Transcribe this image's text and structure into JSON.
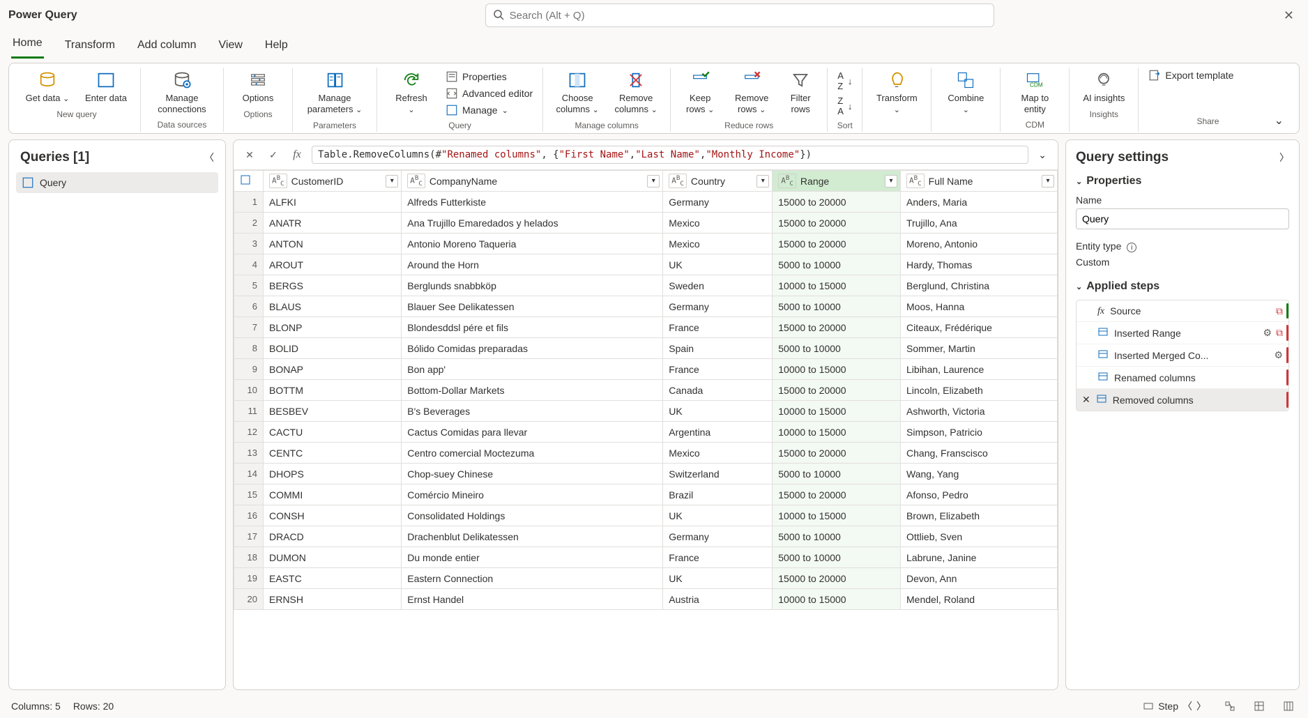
{
  "title": "Power Query",
  "search_placeholder": "Search (Alt + Q)",
  "tabs": [
    "Home",
    "Transform",
    "Add column",
    "View",
    "Help"
  ],
  "active_tab": 0,
  "ribbon": {
    "get_data": "Get data",
    "enter_data": "Enter data",
    "new_query": "New query",
    "manage_connections": "Manage connections",
    "data_sources": "Data sources",
    "options": "Options",
    "options_group": "Options",
    "manage_parameters": "Manage parameters",
    "parameters": "Parameters",
    "refresh": "Refresh",
    "properties": "Properties",
    "advanced_editor": "Advanced editor",
    "manage": "Manage",
    "query_group": "Query",
    "choose_columns": "Choose columns",
    "remove_columns": "Remove columns",
    "manage_columns": "Manage columns",
    "keep_rows": "Keep rows",
    "remove_rows": "Remove rows",
    "filter_rows": "Filter rows",
    "reduce_rows": "Reduce rows",
    "sort": "Sort",
    "transform": "Transform",
    "combine": "Combine",
    "map_to_entity": "Map to entity",
    "cdm": "CDM",
    "ai_insights": "AI insights",
    "insights": "Insights",
    "export_template": "Export template",
    "share": "Share"
  },
  "queries": {
    "title": "Queries [1]",
    "items": [
      "Query"
    ]
  },
  "formula": {
    "prefix": "Table.RemoveColumns(#",
    "arg1": "\"Renamed columns\"",
    "mid": ", {",
    "s1": "\"First Name\"",
    "s2": "\"Last Name\"",
    "s3": "\"Monthly Income\"",
    "suffix": "})"
  },
  "columns": [
    {
      "label": "CustomerID",
      "type": "ABC",
      "selected": false
    },
    {
      "label": "CompanyName",
      "type": "ABC",
      "selected": false
    },
    {
      "label": "Country",
      "type": "ABC",
      "selected": false
    },
    {
      "label": "Range",
      "type": "ABC",
      "selected": true
    },
    {
      "label": "Full Name",
      "type": "ABC",
      "selected": false
    }
  ],
  "rows": [
    [
      "ALFKI",
      "Alfreds Futterkiste",
      "Germany",
      "15000 to 20000",
      "Anders, Maria"
    ],
    [
      "ANATR",
      "Ana Trujillo Emaredados y helados",
      "Mexico",
      "15000 to 20000",
      "Trujillo, Ana"
    ],
    [
      "ANTON",
      "Antonio Moreno Taqueria",
      "Mexico",
      "15000 to 20000",
      "Moreno, Antonio"
    ],
    [
      "AROUT",
      "Around the Horn",
      "UK",
      "5000 to 10000",
      "Hardy, Thomas"
    ],
    [
      "BERGS",
      "Berglunds snabbköp",
      "Sweden",
      "10000 to 15000",
      "Berglund, Christina"
    ],
    [
      "BLAUS",
      "Blauer See Delikatessen",
      "Germany",
      "5000 to 10000",
      "Moos, Hanna"
    ],
    [
      "BLONP",
      "Blondesddsl pére et fils",
      "France",
      "15000 to 20000",
      "Citeaux, Frédérique"
    ],
    [
      "BOLID",
      "Bólido Comidas preparadas",
      "Spain",
      "5000 to 10000",
      "Sommer, Martin"
    ],
    [
      "BONAP",
      "Bon app'",
      "France",
      "10000 to 15000",
      "Libihan, Laurence"
    ],
    [
      "BOTTM",
      "Bottom-Dollar Markets",
      "Canada",
      "15000 to 20000",
      "Lincoln, Elizabeth"
    ],
    [
      "BESBEV",
      "B's Beverages",
      "UK",
      "10000 to 15000",
      "Ashworth, Victoria"
    ],
    [
      "CACTU",
      "Cactus Comidas para llevar",
      "Argentina",
      "10000 to 15000",
      "Simpson, Patricio"
    ],
    [
      "CENTC",
      "Centro comercial Moctezuma",
      "Mexico",
      "15000 to 20000",
      "Chang, Franscisco"
    ],
    [
      "DHOPS",
      "Chop-suey Chinese",
      "Switzerland",
      "5000 to 10000",
      "Wang, Yang"
    ],
    [
      "COMMI",
      "Comércio Mineiro",
      "Brazil",
      "15000 to 20000",
      "Afonso, Pedro"
    ],
    [
      "CONSH",
      "Consolidated Holdings",
      "UK",
      "10000 to 15000",
      "Brown, Elizabeth"
    ],
    [
      "DRACD",
      "Drachenblut Delikatessen",
      "Germany",
      "5000 to 10000",
      "Ottlieb, Sven"
    ],
    [
      "DUMON",
      "Du monde entier",
      "France",
      "5000 to 10000",
      "Labrune, Janine"
    ],
    [
      "EASTC",
      "Eastern Connection",
      "UK",
      "15000 to 20000",
      "Devon, Ann"
    ],
    [
      "ERNSH",
      "Ernst Handel",
      "Austria",
      "10000 to 15000",
      "Mendel, Roland"
    ]
  ],
  "settings": {
    "title": "Query settings",
    "properties": "Properties",
    "name_label": "Name",
    "name_value": "Query",
    "entity_type_label": "Entity type",
    "entity_type_value": "Custom",
    "applied_steps": "Applied steps",
    "steps": [
      {
        "label": "Source",
        "gear": false,
        "extra": "link"
      },
      {
        "label": "Inserted Range",
        "gear": true,
        "extra": "link"
      },
      {
        "label": "Inserted Merged Co...",
        "gear": true,
        "extra": ""
      },
      {
        "label": "Renamed columns",
        "gear": false,
        "extra": ""
      },
      {
        "label": "Removed columns",
        "gear": false,
        "extra": "",
        "selected": true,
        "delete": true
      }
    ]
  },
  "status": {
    "columns": "Columns: 5",
    "rows": "Rows: 20",
    "step": "Step"
  }
}
